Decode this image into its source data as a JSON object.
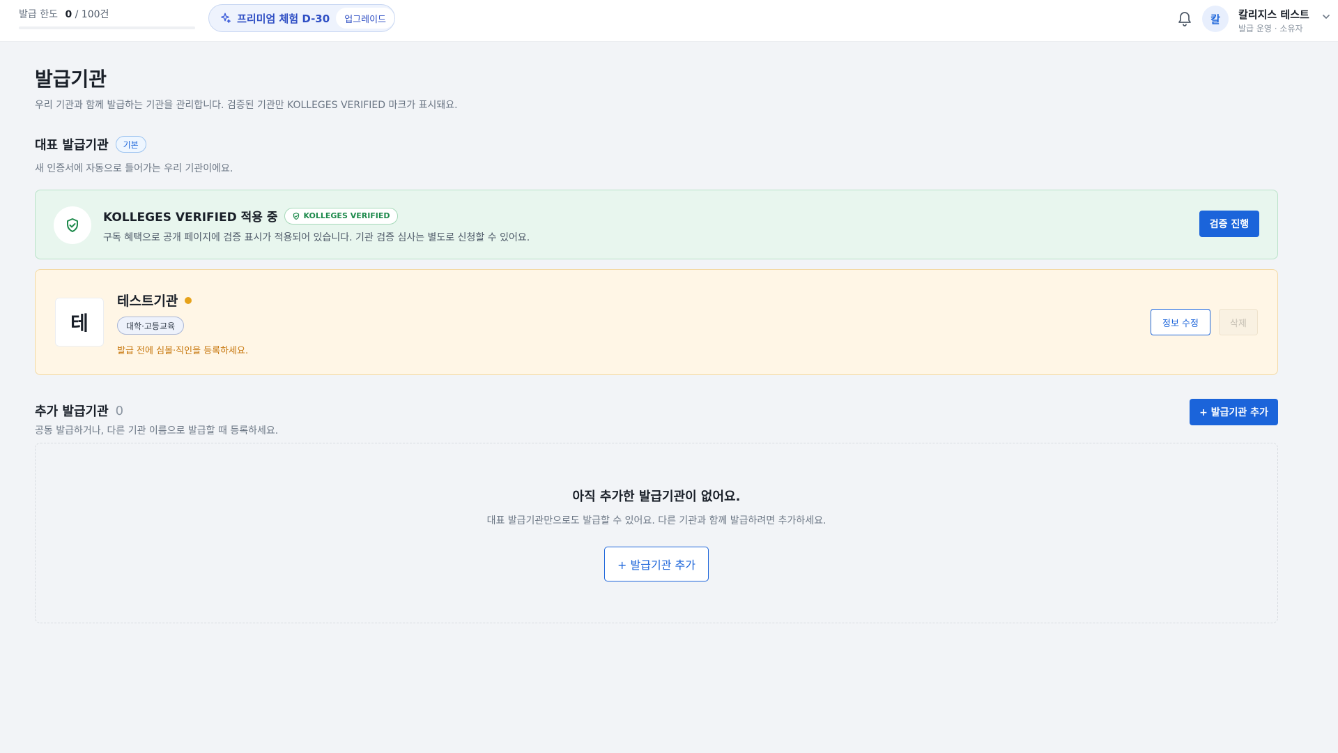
{
  "header": {
    "quota": {
      "label": "발급 한도",
      "count": "0",
      "total": "/ 100건",
      "used_fraction": 0
    },
    "trial": {
      "icon": "sparkle-icon",
      "text": "프리미엄 체험 D-30",
      "upgrade_label": "업그레이드"
    },
    "notifications_icon": "bell-icon",
    "user": {
      "avatar_initial": "칼",
      "name": "칼리지스 테스트",
      "role": "발급 운영 · 소유자",
      "menu_icon": "chevron-down-icon"
    }
  },
  "page": {
    "title": "발급기관",
    "description": "우리 기관과 함께 발급하는 기관을 관리합니다. 검증된 기관만 KOLLEGES VERIFIED 마크가 표시돼요."
  },
  "primary_section": {
    "title": "대표 발급기관",
    "badge": "기본",
    "description": "새 인증서에 자동으로 들어가는 우리 기관이에요."
  },
  "verified_card": {
    "icon": "shield-check-icon",
    "title": "KOLLEGES VERIFIED 적용 중",
    "badge": "KOLLEGES VERIFIED",
    "description": "구독 혜택으로 공개 페이지에 검증 표시가 적용되어 있습니다. 기관 검증 심사는 별도로 신청할 수 있어요.",
    "button_label": "검증 진행"
  },
  "org_card": {
    "logo_initial": "테",
    "name": "테스트기관",
    "category": "대학·고등교육",
    "warning": "발급 전에 심볼·직인을 등록하세요.",
    "edit_label": "정보 수정",
    "delete_label": "삭제",
    "status_color": "#e6a21a"
  },
  "additional_section": {
    "title": "추가 발급기관",
    "count": "0",
    "description": "공동 발급하거나, 다른 기관 이름으로 발급할 때 등록하세요.",
    "add_button_label": "+ 발급기관 추가"
  },
  "empty_state": {
    "title": "아직 추가한 발급기관이 없어요.",
    "description": "대표 발급기관만으로도 발급할 수 있어요. 다른 기관과 함께 발급하려면 추가하세요.",
    "button_label": "+ 발급기관 추가"
  },
  "colors": {
    "accent": "#1b64da",
    "verified_green": "#1e8a4c",
    "warning_orange": "#c7770d"
  }
}
